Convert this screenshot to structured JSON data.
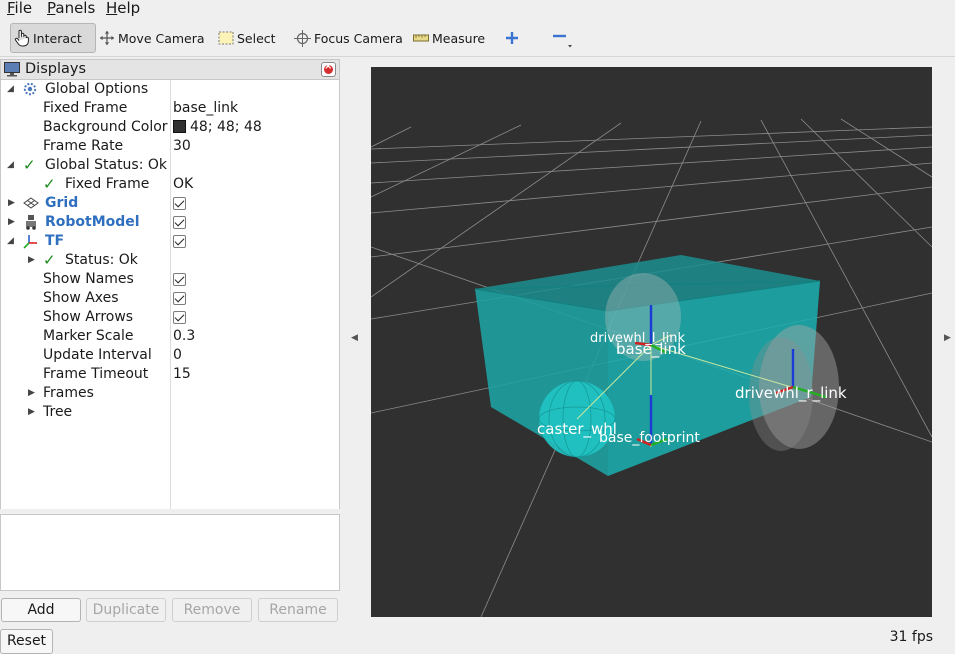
{
  "menubar": {
    "items": [
      {
        "label": "File",
        "u": "F",
        "rest": "ile"
      },
      {
        "label": "Panels",
        "u": "P",
        "rest": "anels"
      },
      {
        "label": "Help",
        "u": "H",
        "rest": "elp"
      }
    ]
  },
  "toolbar": {
    "interact": "Interact",
    "move_camera": "Move Camera",
    "select": "Select",
    "focus_camera": "Focus Camera",
    "measure": "Measure"
  },
  "displays": {
    "title": "Displays",
    "global_options": "Global Options",
    "fixed_frame_label": "Fixed Frame",
    "fixed_frame_value": "base_link",
    "bg_color_label": "Background Color",
    "bg_color_value": "48; 48; 48",
    "frame_rate_label": "Frame Rate",
    "frame_rate_value": "30",
    "global_status": "Global Status: Ok",
    "gs_fixed_frame": "Fixed Frame",
    "gs_fixed_frame_value": "OK",
    "grid": "Grid",
    "robot_model": "RobotModel",
    "tf": "TF",
    "tf_status": "Status: Ok",
    "show_names": "Show Names",
    "show_axes": "Show Axes",
    "show_arrows": "Show Arrows",
    "marker_scale_label": "Marker Scale",
    "marker_scale_value": "0.3",
    "update_interval_label": "Update Interval",
    "update_interval_value": "0",
    "frame_timeout_label": "Frame Timeout",
    "frame_timeout_value": "15",
    "frames": "Frames",
    "tree": "Tree"
  },
  "buttons": {
    "add": "Add",
    "duplicate": "Duplicate",
    "remove": "Remove",
    "rename": "Rename",
    "reset": "Reset"
  },
  "viewport": {
    "background": "#303030",
    "labels": {
      "drivewhl_l": "drivewhl_l_link",
      "base_link": "base_link",
      "drivewhl_r": "drivewhl_r_link",
      "caster": "caster_whl",
      "base_footprint": "base_footprint"
    }
  },
  "status": {
    "fps": "31 fps"
  },
  "colors": {
    "accent_blue": "#2f6fc0",
    "robot_cyan": "#1aa6a6",
    "ok_green": "#1b8a1b"
  }
}
